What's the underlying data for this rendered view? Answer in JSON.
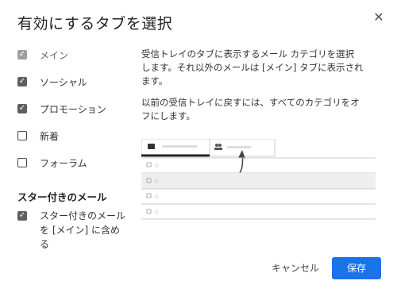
{
  "dialog": {
    "title": "有効にするタブを選択",
    "close_icon": "✕"
  },
  "options": [
    {
      "label": "メイン",
      "checked": true,
      "disabled": true
    },
    {
      "label": "ソーシャル",
      "checked": true,
      "disabled": false
    },
    {
      "label": "プロモーション",
      "checked": true,
      "disabled": false
    },
    {
      "label": "新着",
      "checked": false,
      "disabled": false
    },
    {
      "label": "フォーラム",
      "checked": false,
      "disabled": false
    }
  ],
  "starred": {
    "heading": "スター付きのメール",
    "label_line1": "スター付きのメール",
    "label_line2": "を [メイン] に含める",
    "checked": true
  },
  "description": {
    "line1": "受信トレイのタブに表示するメール カテゴリを選択",
    "line2": "します。それ以外のメールは [メイン] タブに表示され",
    "line3": "ます。",
    "line4": "以前の受信トレイに戻すには、すべてのカテゴリをオ",
    "line5": "フにします。"
  },
  "buttons": {
    "cancel": "キャンセル",
    "save": "保存"
  },
  "colors": {
    "accent": "#1a73e8",
    "checkbox_checked": "#5f5f5f",
    "checkbox_disabled": "#9e9e9e"
  }
}
